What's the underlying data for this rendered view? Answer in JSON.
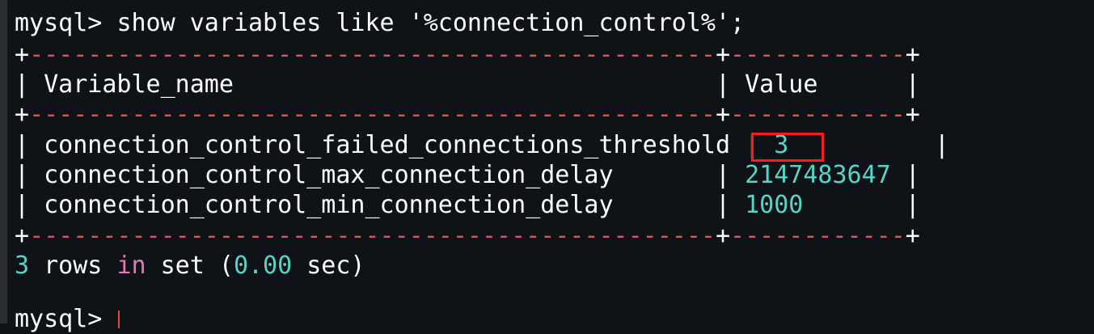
{
  "terminal": {
    "prompt": "mysql>",
    "command": "show variables like '%connection_control%';",
    "table": {
      "header_name": "Variable_name",
      "header_value": "Value",
      "rows": [
        {
          "name": "connection_control_failed_connections_threshold",
          "value": "3"
        },
        {
          "name": "connection_control_max_connection_delay",
          "value": "2147483647"
        },
        {
          "name": "connection_control_min_connection_delay",
          "value": "1000"
        }
      ]
    },
    "summary": {
      "count": "3",
      "rows_word": "rows",
      "in_word": "in",
      "set_word": "set",
      "time_open": "(",
      "time": "0.00",
      "time_unit": "sec)"
    },
    "next_prompt": "mysql>"
  },
  "colors": {
    "background": "#0f1216",
    "border_dash": "#e05548",
    "number": "#58d3c7",
    "keyword": "#e478b6",
    "highlight": "#ff1a1a"
  }
}
